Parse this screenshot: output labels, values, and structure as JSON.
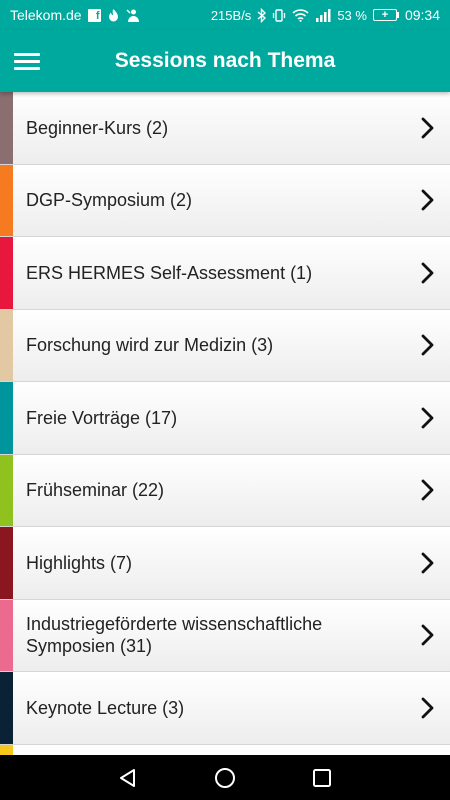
{
  "status_bar": {
    "carrier": "Telekom.de",
    "speed": "215B/s",
    "battery": "53 %",
    "battery_icon": "+",
    "time": "09:34"
  },
  "app_bar": {
    "title": "Sessions nach Thema"
  },
  "topics": [
    {
      "label": "Beginner-Kurs (2)",
      "color": "#8b6e70"
    },
    {
      "label": "DGP-Symposium (2)",
      "color": "#f57a20"
    },
    {
      "label": "ERS HERMES Self-Assessment (1)",
      "color": "#e8173e"
    },
    {
      "label": "Forschung wird zur Medizin (3)",
      "color": "#e3c9a3"
    },
    {
      "label": "Freie Vorträge (17)",
      "color": "#00949c"
    },
    {
      "label": "Frühseminar (22)",
      "color": "#8fc21e"
    },
    {
      "label": "Highlights (7)",
      "color": "#8a1620"
    },
    {
      "label": "Industriegeförderte wissenschaftliche Symposien (31)",
      "color": "#ec6a90"
    },
    {
      "label": "Keynote Lecture (3)",
      "color": "#0a2236"
    },
    {
      "label": "",
      "color": "#f6c71c"
    }
  ]
}
